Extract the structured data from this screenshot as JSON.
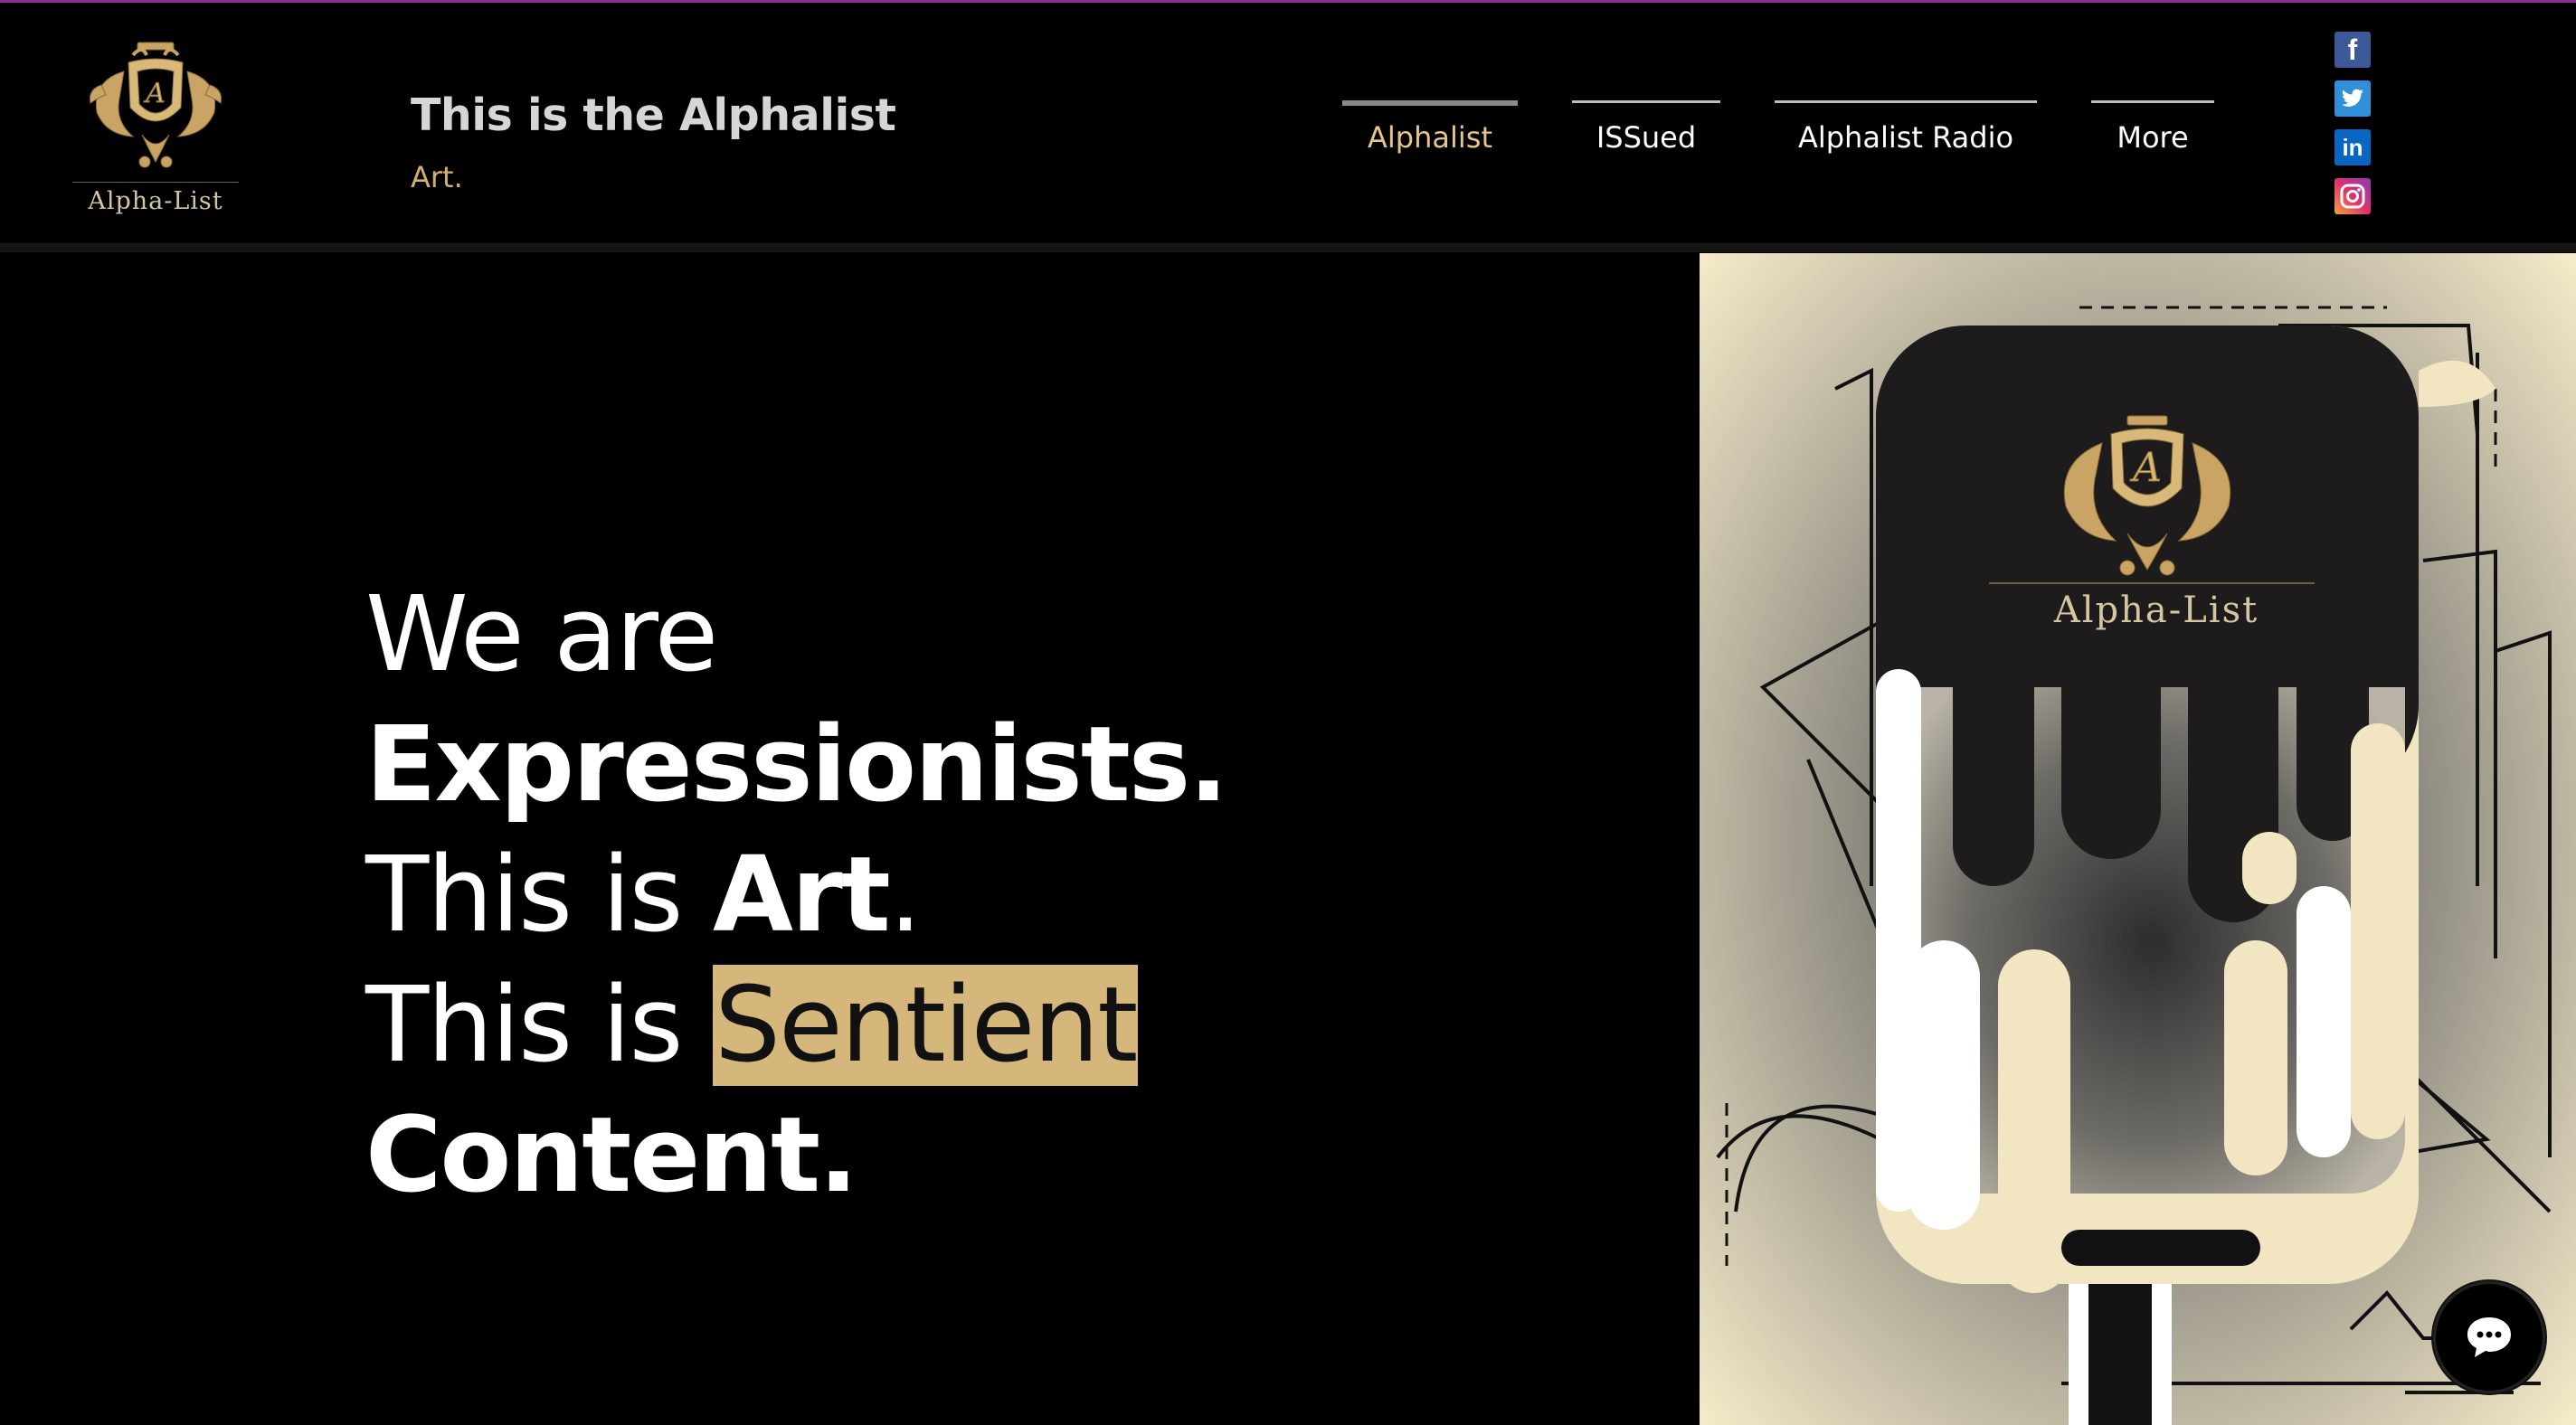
{
  "header": {
    "logo_text": "Alpha-List",
    "title": "This is the Alphalist",
    "subtitle": "Art."
  },
  "nav": {
    "items": [
      {
        "label": "Alphalist",
        "active": true
      },
      {
        "label": "ISSued",
        "active": false
      },
      {
        "label": "Alphalist Radio",
        "active": false
      },
      {
        "label": "More",
        "active": false
      }
    ]
  },
  "social": [
    {
      "icon": "facebook-icon",
      "glyph": "f"
    },
    {
      "icon": "twitter-icon",
      "glyph": ""
    },
    {
      "icon": "linkedin-icon",
      "glyph": "in"
    },
    {
      "icon": "instagram-icon",
      "glyph": ""
    }
  ],
  "hero": {
    "line1": "We are",
    "line2": "Expressionists.",
    "line3_prefix": "This is ",
    "line3_bold": "Art",
    "line3_suffix": ".",
    "line4_prefix": "This is ",
    "line4_highlight": "Sentient",
    "line5": "Content."
  },
  "art": {
    "logo_text": "Alpha-List"
  },
  "colors": {
    "accent_gold": "#d6b77b",
    "nav_active": "#e6c48a",
    "background": "#000000",
    "art_cream": "#f4e9c8"
  },
  "chat": {
    "icon": "chat-icon"
  }
}
